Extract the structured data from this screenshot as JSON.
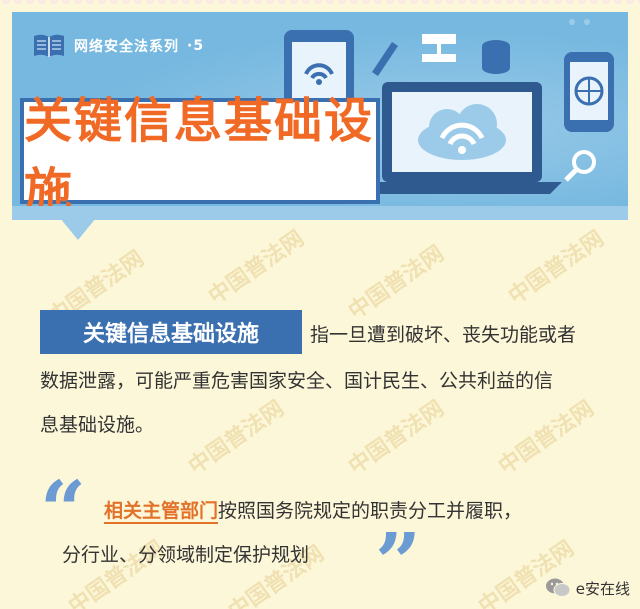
{
  "header": {
    "series_label": "网络安全法系列",
    "series_number": "·5",
    "title": "关键信息基础设施"
  },
  "definition": {
    "term": "关键信息基础设施",
    "line1": "指一旦遭到破坏、丧失功能或者",
    "line2": "数据泄露，可能严重危害国家安全、国计民生、公共利益的信",
    "line3": "息基础设施。"
  },
  "quote": {
    "highlight": "相关主管部门",
    "line1_rest": "按照国务院规定的职责分工并履职，",
    "line2": "分行业、分领域制定保护规划"
  },
  "watermark": {
    "text": "中国普法网"
  },
  "logo": {
    "text": "e安在线"
  },
  "colors": {
    "banner": "#76b8e0",
    "accent_orange": "#f06a26",
    "dark_blue": "#3a6fb0",
    "background": "#fdf7d9"
  }
}
